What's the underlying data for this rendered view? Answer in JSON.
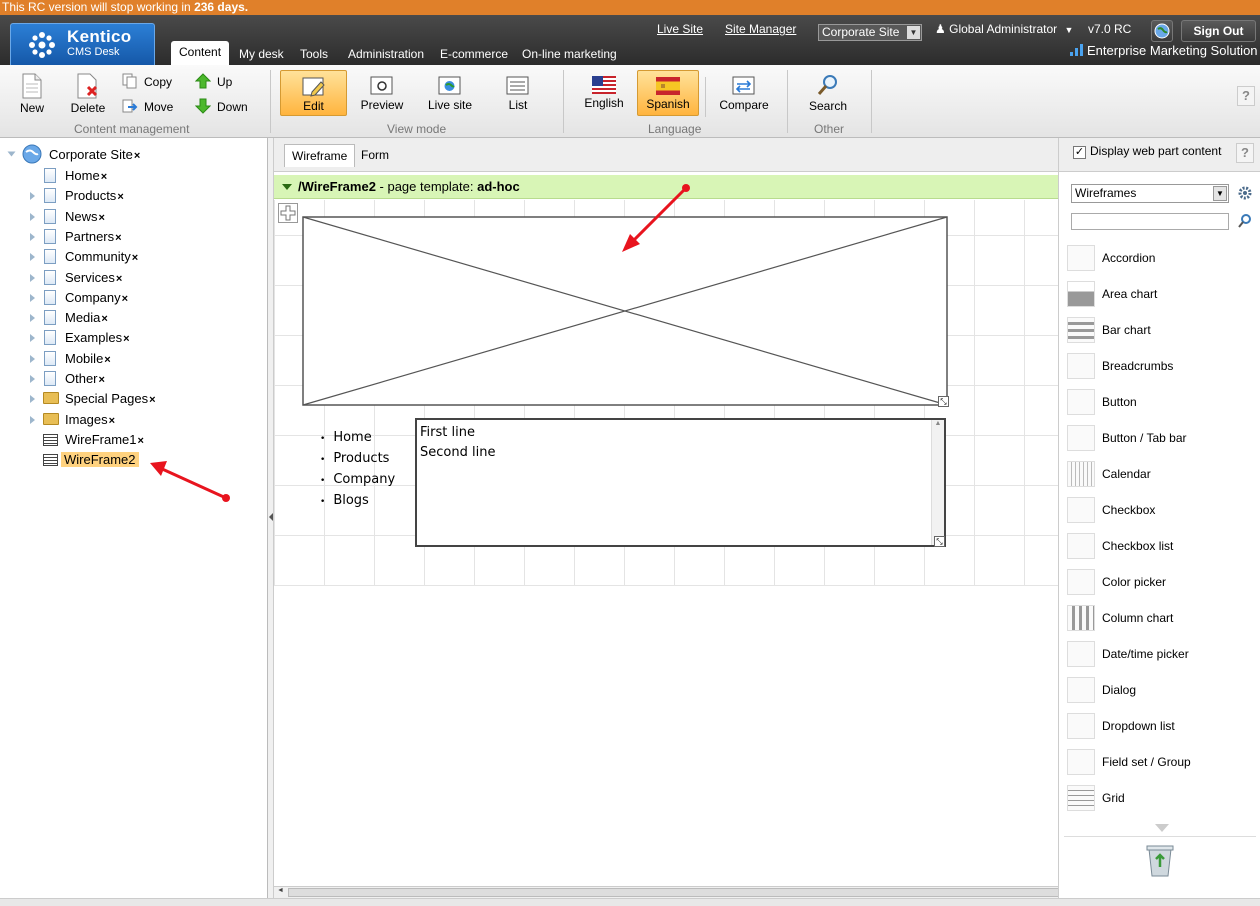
{
  "banner": {
    "prefix": "This RC version will stop working in",
    "days": "236 days."
  },
  "header": {
    "logo_name": "Kentico",
    "logo_sub": "CMS Desk",
    "live_site": "Live Site",
    "site_manager": "Site Manager",
    "site_select": "Corporate Site",
    "user": "Global Administrator",
    "version": "v7.0 RC",
    "sign_out": "Sign Out",
    "ems": "Enterprise Marketing Solution",
    "tabs": [
      "Content",
      "My desk",
      "Tools",
      "Administration",
      "E-commerce",
      "On-line marketing"
    ]
  },
  "toolbar": {
    "new": "New",
    "delete": "Delete",
    "copy": "Copy",
    "move": "Move",
    "up": "Up",
    "down": "Down",
    "group_content": "Content management",
    "edit": "Edit",
    "preview": "Preview",
    "live_site": "Live site",
    "list": "List",
    "group_view": "View mode",
    "english": "English",
    "spanish": "Spanish",
    "compare": "Compare",
    "group_language": "Language",
    "search": "Search",
    "group_other": "Other",
    "help": "?"
  },
  "tree": {
    "root": "Corporate Site",
    "items": [
      "Home",
      "Products",
      "News",
      "Partners",
      "Community",
      "Services",
      "Company",
      "Media",
      "Examples",
      "Mobile",
      "Other",
      "Special Pages",
      "Images",
      "WireFrame1",
      "WireFrame2"
    ],
    "remove_mark": "×"
  },
  "center": {
    "tab_wireframe": "Wireframe",
    "tab_form": "Form",
    "zone_path": "/WireFrame2",
    "zone_mid": " - page template: ",
    "zone_template": "ad-hoc",
    "menu_items": [
      "Home",
      "Products",
      "Company",
      "Blogs"
    ],
    "text_lines": [
      "First line",
      "Second line"
    ]
  },
  "right": {
    "display_web_part": "Display web part content",
    "category": "Wireframes",
    "search_placeholder": "",
    "items": [
      "Accordion",
      "Area chart",
      "Bar chart",
      "Breadcrumbs",
      "Button",
      "Button / Tab bar",
      "Calendar",
      "Checkbox",
      "Checkbox list",
      "Color picker",
      "Column chart",
      "Date/time picker",
      "Dialog",
      "Dropdown list",
      "Field set / Group",
      "Grid"
    ]
  },
  "colors": {
    "banner": "#e0802a",
    "highlight": "#ffb43e",
    "zone": "#d8f5b6",
    "arrow": "#e8141e"
  }
}
